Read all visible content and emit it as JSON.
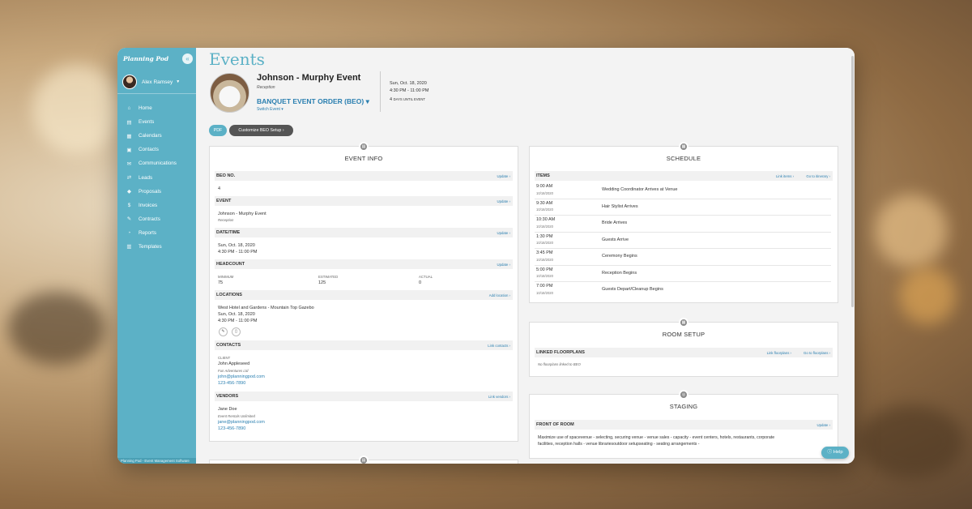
{
  "sidebar": {
    "logo": "Planning Pod",
    "collapse_icon": "«",
    "user_name": "Alex Ramsey",
    "items": [
      {
        "icon": "home-icon",
        "glyph": "⌂",
        "label": "Home"
      },
      {
        "icon": "events-icon",
        "glyph": "▤",
        "label": "Events"
      },
      {
        "icon": "calendar-icon",
        "glyph": "▦",
        "label": "Calendars"
      },
      {
        "icon": "contacts-icon",
        "glyph": "▣",
        "label": "Contacts"
      },
      {
        "icon": "communications-icon",
        "glyph": "✉",
        "label": "Communications"
      },
      {
        "icon": "leads-icon",
        "glyph": "⇄",
        "label": "Leads"
      },
      {
        "icon": "proposals-icon",
        "glyph": "◆",
        "label": "Proposals"
      },
      {
        "icon": "invoices-icon",
        "glyph": "$",
        "label": "Invoices"
      },
      {
        "icon": "contracts-icon",
        "glyph": "✎",
        "label": "Contracts"
      },
      {
        "icon": "reports-icon",
        "glyph": "◔",
        "label": "Reports"
      },
      {
        "icon": "templates-icon",
        "glyph": "▥",
        "label": "Templates"
      }
    ],
    "footer": "Planning Pod - Event Management Software"
  },
  "header": {
    "title": "Events",
    "event_name": "Johnson - Murphy Event",
    "event_sub": "Reception",
    "beo_title": "BANQUET EVENT ORDER (BEO) ▾",
    "switch_event": "Switch Event ▾",
    "date": "Sun, Oct. 18, 2020",
    "time": "4:30 PM - 11:00 PM",
    "days_num": "4",
    "days_text": "DAYS UNTIL EVENT",
    "pdf_btn": "PDF",
    "customize_btn": "Customize BEO Setup ›"
  },
  "event_info": {
    "title": "EVENT INFO",
    "beo_no_label": "BEO NO.",
    "beo_no": "4",
    "update": "Update ›",
    "event_label": "EVENT",
    "event_name": "Johnson - Murphy Event",
    "event_type": "Reception",
    "datetime_label": "DATE/TIME",
    "date": "Sun, Oct. 18, 2020",
    "time": "4:30 PM - 11:00 PM",
    "headcount_label": "HEADCOUNT",
    "min_label": "MINIMUM",
    "min_value": "75",
    "est_label": "ESTIMATED",
    "est_value": "125",
    "act_label": "ACTUAL",
    "act_value": "0",
    "locations_label": "LOCATIONS",
    "add_location": "Add location ›",
    "location_name": "West Hotel and Gardens - Mountain Top Gazebo",
    "location_date": "Sun, Oct. 18, 2020",
    "location_time": "4:30 PM - 11:00 PM",
    "contacts_label": "CONTACTS",
    "link_contacts": "Link contacts ›",
    "client_label": "CLIENT",
    "client_name": "John Appleseed",
    "client_company": "Fun Adventures Ltd",
    "client_email": "john@planningpod.com",
    "client_phone": "123-456-7890",
    "vendors_label": "VENDORS",
    "link_vendors": "Link vendors ›",
    "vendor_name": "Jane Doe",
    "vendor_company": "Event Rentals Unlimited",
    "vendor_email": "jane@planningpod.com",
    "vendor_phone": "123-456-7890"
  },
  "schedule": {
    "title": "SCHEDULE",
    "items_label": "ITEMS",
    "link_items": "Link items ›",
    "go_itinerary": "Go to itinerary ›",
    "rows": [
      {
        "time": "9:00 AM",
        "date": "10/18/2020",
        "desc": "Wedding Coordinator Arrives at Venue"
      },
      {
        "time": "9:30 AM",
        "date": "10/18/2020",
        "desc": "Hair Stylist Arrives"
      },
      {
        "time": "10:30 AM",
        "date": "10/18/2020",
        "desc": "Bride Arrives"
      },
      {
        "time": "1:30 PM",
        "date": "10/18/2020",
        "desc": "Guests Arrive"
      },
      {
        "time": "3:45 PM",
        "date": "10/18/2020",
        "desc": "Ceremony Begins"
      },
      {
        "time": "5:00 PM",
        "date": "10/18/2020",
        "desc": "Reception Begins"
      },
      {
        "time": "7:00 PM",
        "date": "10/18/2020",
        "desc": "Guests Depart/Cleanup Begins"
      }
    ]
  },
  "room_setup": {
    "title": "ROOM SETUP",
    "label": "LINKED FLOORPLANS",
    "link_floorplans": "Link floorplans ›",
    "go_floorplans": "Go to floorplans ›",
    "empty": "No floorplans linked to BEO"
  },
  "staging": {
    "title": "STAGING",
    "label": "FRONT OF ROOM",
    "update": "Update ›",
    "line1": "Maximize use of spacevenue - selecting, securing venue - venue sales - capacity - event centers, hotels, restaurants, corporate",
    "line2": "facilities, reception halls - venue librariesoutdoor setupseating - seating arrangements -"
  },
  "help": "ⓘ Help"
}
